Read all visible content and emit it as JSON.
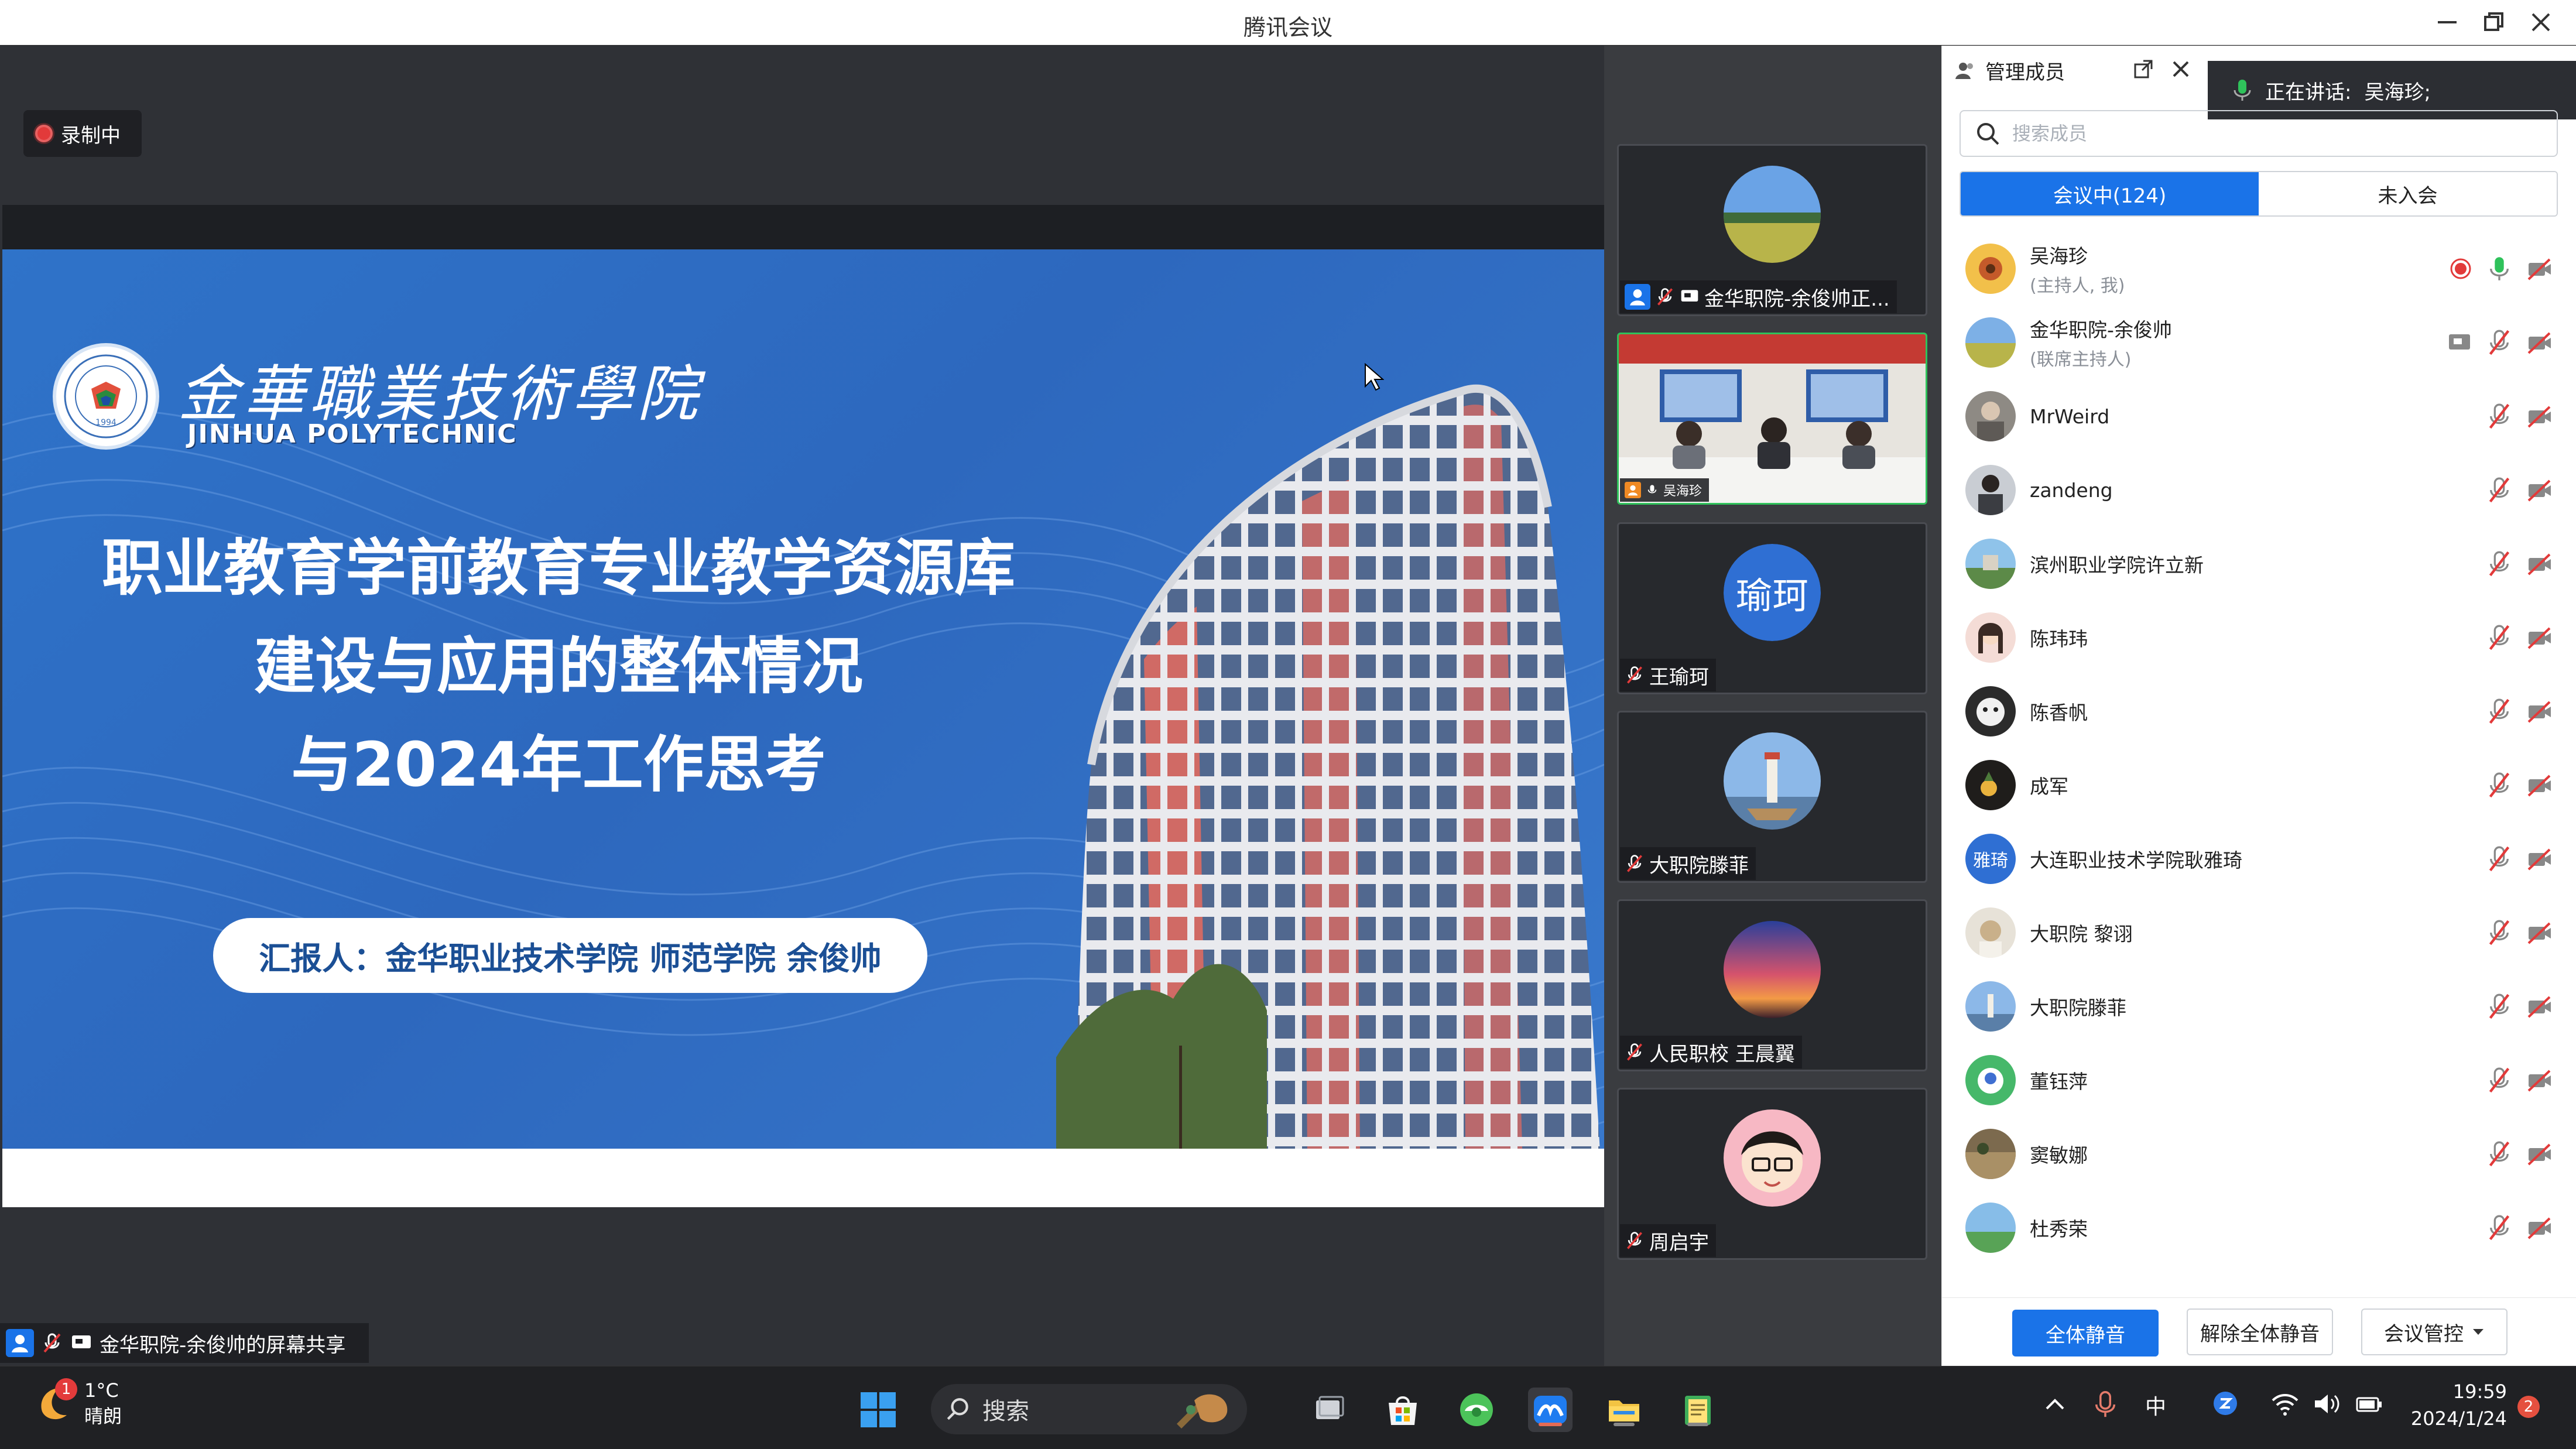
{
  "window": {
    "title": "腾讯会议"
  },
  "stage": {
    "recording_label": "录制中",
    "share_label": "金华职院-余俊帅的屏幕共享"
  },
  "slide": {
    "school_cn": "金華職業技術學院",
    "school_en": "JINHUA POLYTECHNIC",
    "logo_year": "1994",
    "title_lines": [
      "职业教育学前教育专业教学资源库",
      "建设与应用的整体情况",
      "与2024年工作思考"
    ],
    "reporter": "汇报人：金华职业技术学院 师范学院  余俊帅",
    "colors": {
      "blue": "#2f73c9",
      "accent_red": "#e66a5e"
    }
  },
  "video_tiles": [
    {
      "name": "金华职院-余俊帅正...",
      "avatar": "landscape-avatar"
    },
    {
      "name": "吴海珍",
      "avatar": "meeting-room-video"
    },
    {
      "name": "王瑜珂",
      "avatar": "initials",
      "initials": "瑜珂"
    },
    {
      "name": "大职院滕菲",
      "avatar": "lighthouse-avatar"
    },
    {
      "name": "人民职校 王晨翼",
      "avatar": "sunset-avatar"
    },
    {
      "name": "周启宇",
      "avatar": "cartoon-avatar"
    }
  ],
  "panel": {
    "title": "管理成员",
    "speaking_label": "正在讲话:",
    "speaking_name": "吴海珍;",
    "search_placeholder": "搜索成员",
    "tab_in_meeting": "会议中(124)",
    "tab_not_joined": "未入会",
    "members": [
      {
        "name": "吴海珍",
        "role": "(主持人, 我)",
        "recording": true,
        "mic_on": true
      },
      {
        "name": "金华职院-余俊帅",
        "role": "(联席主持人)",
        "sharing": true
      },
      {
        "name": "MrWeird",
        "role": ""
      },
      {
        "name": "zandeng",
        "role": ""
      },
      {
        "name": "滨州职业学院许立新",
        "role": ""
      },
      {
        "name": "陈玮玮",
        "role": ""
      },
      {
        "name": "陈香帆",
        "role": ""
      },
      {
        "name": "成军",
        "role": ""
      },
      {
        "name": "大连职业技术学院耿雅琦",
        "role": "",
        "initials": "雅琦"
      },
      {
        "name": "大职院 黎诩",
        "role": ""
      },
      {
        "name": "大职院滕菲",
        "role": ""
      },
      {
        "name": "董钰萍",
        "role": ""
      },
      {
        "name": "窦敏娜",
        "role": ""
      },
      {
        "name": "杜秀荣",
        "role": ""
      }
    ],
    "mute_all": "全体静音",
    "unmute_all": "解除全体静音",
    "meeting_control": "会议管控"
  },
  "taskbar": {
    "weather_temp": "1°C",
    "weather_cond": "晴朗",
    "weather_badge": "1",
    "search_label": "搜索",
    "ime": "中",
    "time": "19:59",
    "date": "2024/1/24",
    "notif_count": "2"
  }
}
